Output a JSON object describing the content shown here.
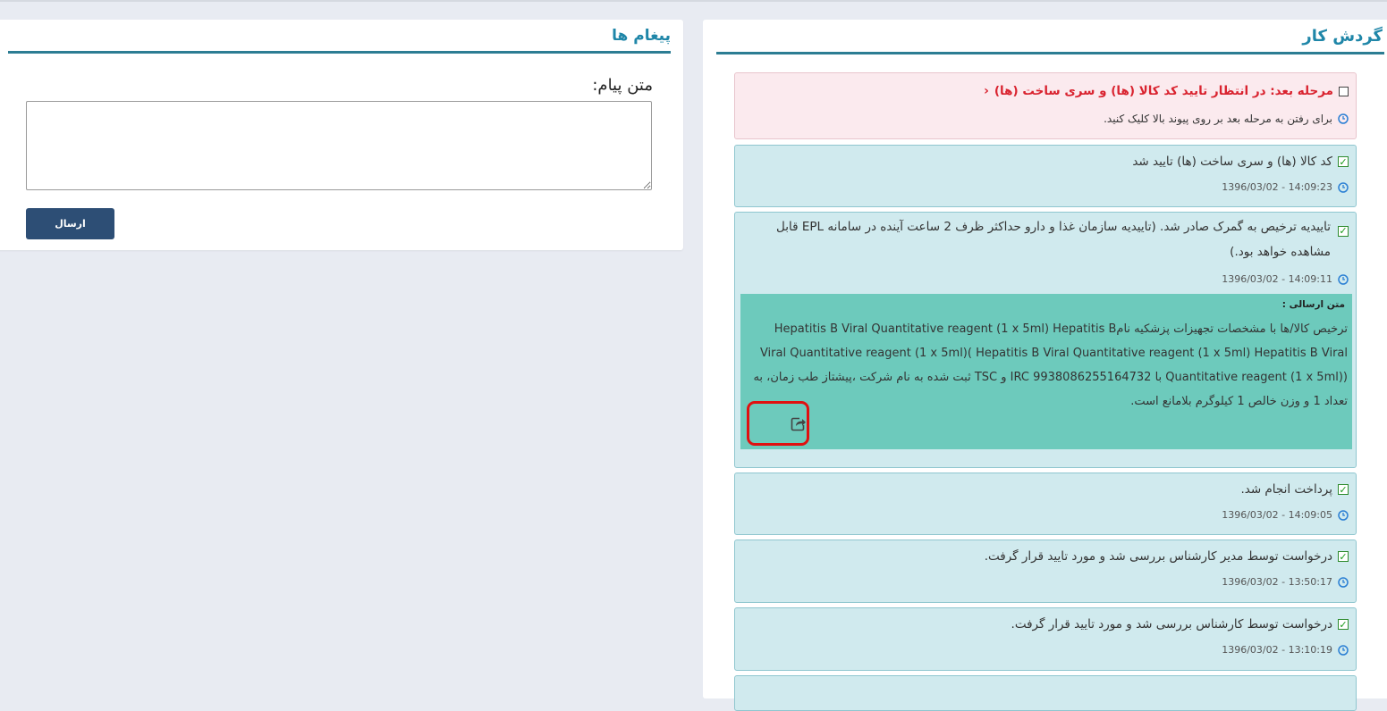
{
  "messages": {
    "title": "پیغام ها",
    "label": "متن پیام:",
    "textarea_value": "",
    "send_label": "ارسال"
  },
  "workflow": {
    "title": "گردش کار",
    "next_step": {
      "text": "مرحله بعد: در انتظار تایید کد کالا (ها) و سری ساخت (ها)",
      "hint": "برای رفتن به مرحله بعد بر روی پیوند بالا کلیک کنید."
    },
    "steps": [
      {
        "text": "کد کالا (ها) و سری ساخت (ها) تایید شد",
        "time": "1396/03/02 - 14:09:23"
      },
      {
        "text": "تاییدیه ترخیص به گمرک صادر شد. (تاییدیه سازمان غذا و دارو حداکثر ظرف 2 ساعت آینده در سامانه EPL قابل مشاهده خواهد بود.)",
        "time": "1396/03/02 - 14:09:11",
        "sent_label": "متن ارسالی :",
        "sent_text": "ترخیص کالا/ها با مشخصات تجهیزات پزشکیه نامHepatitis B Viral Quantitative reagent (1 x 5ml) Hepatitis B Viral Quantitative reagent (1 x 5ml)( Hepatitis B Viral Quantitative reagent (1 x 5ml) Hepatitis B Viral Quantitative reagent (1 x 5ml)) با IRC 9938086255164732 و TSC ثبت شده به نام شرکت ،پیشتاز طب زمان، به تعداد 1 و وزن خالص 1 کیلوگرم بلامانع است."
      },
      {
        "text": "پرداخت انجام شد.",
        "time": "1396/03/02 - 14:09:05"
      },
      {
        "text": "درخواست توسط مدیر کارشناس بررسی شد و مورد تایید قرار گرفت.",
        "time": "1396/03/02 - 13:50:17"
      },
      {
        "text": "درخواست توسط کارشناس بررسی شد و مورد تایید قرار گرفت.",
        "time": "1396/03/02 - 13:10:19"
      }
    ]
  },
  "colors": {
    "accent": "#1f86a8",
    "rule": "#2c7d93",
    "card_bg": "#d0eaee",
    "pending_bg": "#fbeaee",
    "sent_bg": "#6dcabc",
    "button": "#2d4e75",
    "highlight": "#e01010"
  },
  "icons": [
    "checkbox-icon",
    "checked-icon",
    "clock-icon",
    "chevron-left-icon",
    "share-icon",
    "resize-grip-icon"
  ]
}
